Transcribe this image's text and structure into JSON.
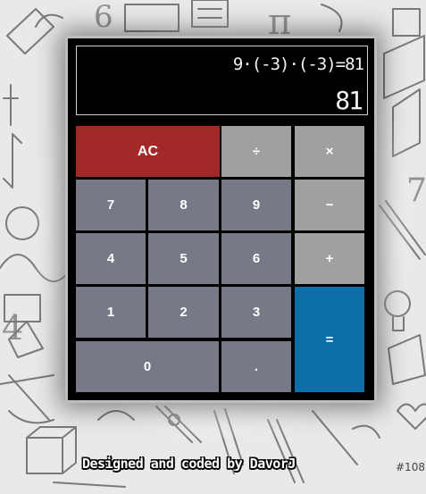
{
  "display": {
    "formula": "9·(-3)·(-3)=81",
    "result": "81"
  },
  "keys": {
    "clear": "AC",
    "divide": "÷",
    "multiply": "×",
    "subtract": "−",
    "add": "+",
    "equals": "=",
    "decimal": ".",
    "d0": "0",
    "d1": "1",
    "d2": "2",
    "d3": "3",
    "d4": "4",
    "d5": "5",
    "d6": "6",
    "d7": "7",
    "d8": "8",
    "d9": "9"
  },
  "footer": {
    "credit": "Designed and coded by DavorJ",
    "badge": "#108"
  },
  "colors": {
    "clear_key": "#a32828",
    "equals_key": "#0a6fa8",
    "number_key": "#777a86",
    "operator_key": "#a0a0a2"
  }
}
